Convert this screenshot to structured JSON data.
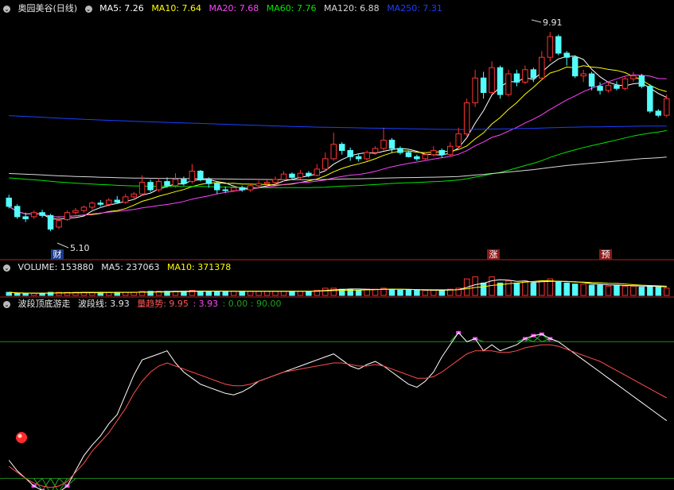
{
  "header": {
    "stock_name": "奥园美谷(日线)",
    "ma": [
      {
        "label": "MA5: 7.26",
        "color": "#ffffff"
      },
      {
        "label": "MA10: 7.64",
        "color": "#ffff00"
      },
      {
        "label": "MA20: 7.68",
        "color": "#ff44ff"
      },
      {
        "label": "MA60: 7.76",
        "color": "#00e600"
      },
      {
        "label": "MA120: 6.88",
        "color": "#d8d8d8"
      },
      {
        "label": "MA250: 7.31",
        "color": "#1a40ff"
      }
    ]
  },
  "volume_header": {
    "volume": "VOLUME: 153880",
    "ma5": "MA5: 237063",
    "ma10": "MA10: 371378"
  },
  "indicator_header": {
    "name": "波段顶底游走",
    "wave": "波段线: 3.93",
    "trend_label": "量趋势: 9.95",
    "trend_val": ": 3.93",
    "levels": ": 0.00 : 90.00"
  },
  "markers": {
    "cai": "财",
    "zhang": "涨",
    "yu": "预"
  },
  "chart_data": [
    {
      "type": "candlestick",
      "title": "奥园美谷(日线)",
      "annotations": [
        {
          "text": "9.91",
          "kind": "high"
        },
        {
          "text": "5.10",
          "kind": "low"
        }
      ],
      "ylim": [
        4.7,
        10.3
      ],
      "colors": {
        "up": "#ff3232",
        "down": "#54fcfc"
      },
      "candles": [
        [
          5.9,
          5.7,
          5.98,
          5.65
        ],
        [
          5.7,
          5.45,
          5.75,
          5.4
        ],
        [
          5.45,
          5.4,
          5.55,
          5.32
        ],
        [
          5.45,
          5.55,
          5.6,
          5.4
        ],
        [
          5.55,
          5.48,
          5.62,
          5.43
        ],
        [
          5.48,
          5.15,
          5.52,
          5.1
        ],
        [
          5.2,
          5.36,
          5.42,
          5.15
        ],
        [
          5.38,
          5.55,
          5.6,
          5.35
        ],
        [
          5.55,
          5.6,
          5.66,
          5.5
        ],
        [
          5.6,
          5.68,
          5.72,
          5.55
        ],
        [
          5.68,
          5.78,
          5.82,
          5.62
        ],
        [
          5.78,
          5.75,
          5.85,
          5.7
        ],
        [
          5.75,
          5.85,
          5.9,
          5.7
        ],
        [
          5.85,
          5.8,
          5.95,
          5.76
        ],
        [
          5.8,
          5.93,
          6.0,
          5.76
        ],
        [
          5.93,
          6.0,
          6.05,
          5.85
        ],
        [
          6.0,
          6.28,
          6.45,
          5.95
        ],
        [
          6.28,
          6.1,
          6.35,
          6.05
        ],
        [
          6.1,
          6.3,
          6.38,
          6.05
        ],
        [
          6.3,
          6.2,
          6.4,
          6.15
        ],
        [
          6.2,
          6.35,
          6.5,
          6.15
        ],
        [
          6.35,
          6.25,
          6.42,
          6.2
        ],
        [
          6.3,
          6.55,
          6.72,
          6.25
        ],
        [
          6.55,
          6.35,
          6.58,
          6.3
        ],
        [
          6.35,
          6.25,
          6.4,
          6.15
        ],
        [
          6.25,
          6.1,
          6.3,
          6.0
        ],
        [
          6.1,
          6.08,
          6.18,
          6.02
        ],
        [
          6.08,
          6.15,
          6.22,
          6.05
        ],
        [
          6.15,
          6.1,
          6.2,
          6.05
        ],
        [
          6.1,
          6.2,
          6.25,
          6.05
        ],
        [
          6.2,
          6.25,
          6.32,
          6.15
        ],
        [
          6.25,
          6.28,
          6.35,
          6.2
        ],
        [
          6.28,
          6.35,
          6.42,
          6.22
        ],
        [
          6.35,
          6.48,
          6.55,
          6.3
        ],
        [
          6.48,
          6.4,
          6.52,
          6.35
        ],
        [
          6.4,
          6.5,
          6.58,
          6.35
        ],
        [
          6.5,
          6.45,
          6.55,
          6.4
        ],
        [
          6.45,
          6.6,
          6.72,
          6.42
        ],
        [
          6.6,
          6.85,
          7.0,
          6.55
        ],
        [
          6.85,
          7.2,
          7.48,
          6.8
        ],
        [
          7.2,
          7.05,
          7.25,
          6.95
        ],
        [
          7.05,
          6.9,
          7.12,
          6.8
        ],
        [
          6.9,
          6.85,
          6.98,
          6.78
        ],
        [
          6.85,
          7.0,
          7.05,
          6.8
        ],
        [
          7.0,
          7.1,
          7.15,
          6.95
        ],
        [
          7.1,
          7.3,
          7.6,
          7.05
        ],
        [
          7.3,
          7.1,
          7.35,
          7.0
        ],
        [
          7.1,
          7.0,
          7.15,
          6.95
        ],
        [
          7.0,
          6.9,
          7.05,
          6.88
        ],
        [
          6.9,
          6.85,
          6.95,
          6.8
        ],
        [
          6.85,
          6.95,
          7.0,
          6.82
        ],
        [
          6.95,
          7.05,
          7.15,
          6.9
        ],
        [
          7.05,
          6.95,
          7.1,
          6.88
        ],
        [
          6.95,
          7.15,
          7.25,
          6.9
        ],
        [
          7.15,
          7.45,
          7.6,
          7.1
        ],
        [
          7.45,
          8.2,
          8.3,
          7.4
        ],
        [
          8.2,
          8.8,
          9.0,
          8.1
        ],
        [
          8.8,
          8.45,
          8.95,
          8.3
        ],
        [
          8.45,
          9.05,
          9.2,
          8.4
        ],
        [
          9.05,
          8.4,
          9.1,
          8.3
        ],
        [
          8.4,
          8.9,
          9.0,
          8.35
        ],
        [
          8.9,
          8.7,
          9.0,
          8.6
        ],
        [
          8.7,
          9.0,
          9.1,
          8.65
        ],
        [
          9.0,
          8.8,
          9.05,
          8.7
        ],
        [
          8.8,
          9.3,
          9.45,
          8.75
        ],
        [
          9.3,
          9.8,
          9.91,
          9.2
        ],
        [
          9.8,
          9.4,
          9.85,
          9.35
        ],
        [
          9.4,
          9.3,
          9.45,
          9.1
        ],
        [
          9.3,
          8.85,
          9.35,
          8.8
        ],
        [
          8.85,
          8.9,
          9.0,
          8.7
        ],
        [
          8.9,
          8.6,
          8.95,
          8.5
        ],
        [
          8.6,
          8.5,
          8.7,
          8.4
        ],
        [
          8.5,
          8.62,
          8.7,
          8.45
        ],
        [
          8.62,
          8.55,
          8.72,
          8.5
        ],
        [
          8.55,
          8.78,
          8.85,
          8.5
        ],
        [
          8.78,
          8.85,
          8.95,
          8.7
        ],
        [
          8.85,
          8.6,
          8.9,
          8.55
        ],
        [
          8.6,
          8.0,
          8.65,
          7.95
        ],
        [
          8.0,
          7.9,
          8.05,
          7.85
        ],
        [
          7.9,
          8.3,
          8.4,
          7.85
        ]
      ]
    },
    {
      "type": "bar",
      "title": "VOLUME",
      "ylim": [
        0,
        100
      ],
      "values": [
        3,
        2,
        2,
        2,
        2,
        3,
        3,
        3,
        3,
        3,
        3,
        3,
        3,
        3,
        3,
        3,
        4,
        4,
        4,
        4,
        4,
        4,
        5,
        4,
        4,
        4,
        4,
        4,
        4,
        4,
        4,
        4,
        4,
        4,
        4,
        4,
        4,
        5,
        7,
        7,
        6,
        6,
        5,
        6,
        6,
        7,
        6,
        5,
        5,
        5,
        5,
        5,
        5,
        6,
        7,
        16,
        18,
        12,
        18,
        12,
        14,
        12,
        14,
        12,
        14,
        16,
        13,
        12,
        11,
        11,
        10,
        10,
        9,
        10,
        9,
        9,
        8,
        9,
        8,
        7
      ]
    },
    {
      "type": "line",
      "title": "波段顶底游走",
      "ylim": [
        -5,
        110
      ],
      "levels": [
        0,
        90
      ],
      "series": [
        {
          "name": "波段线",
          "color": "#ffffff",
          "values": [
            12,
            5,
            0,
            -5,
            -8,
            -10,
            -9,
            -5,
            5,
            15,
            22,
            28,
            36,
            42,
            55,
            68,
            78,
            80,
            82,
            84,
            76,
            70,
            66,
            62,
            60,
            58,
            56,
            55,
            57,
            60,
            64,
            66,
            68,
            70,
            72,
            74,
            76,
            78,
            80,
            82,
            78,
            74,
            72,
            75,
            77,
            74,
            70,
            66,
            62,
            60,
            64,
            70,
            80,
            88,
            96,
            90,
            92,
            84,
            88,
            84,
            86,
            88,
            92,
            94,
            95,
            92,
            90,
            86,
            82,
            78,
            74,
            70,
            66,
            62,
            58,
            54,
            50,
            46,
            42,
            38
          ]
        },
        {
          "name": "量趋势",
          "color": "#ff4d4d",
          "values": [
            8,
            4,
            0,
            -3,
            -5,
            -6,
            -5,
            -2,
            4,
            10,
            18,
            24,
            30,
            38,
            46,
            56,
            64,
            70,
            74,
            76,
            74,
            72,
            70,
            68,
            66,
            64,
            62,
            61,
            61,
            62,
            64,
            66,
            68,
            70,
            71,
            72,
            73,
            74,
            75,
            76,
            76,
            75,
            74,
            74,
            75,
            74,
            72,
            70,
            68,
            66,
            66,
            67,
            70,
            74,
            78,
            82,
            84,
            84,
            84,
            83,
            83,
            84,
            86,
            87,
            88,
            88,
            87,
            85,
            83,
            81,
            79,
            77,
            74,
            71,
            68,
            65,
            62,
            59,
            56,
            53
          ]
        }
      ]
    }
  ]
}
